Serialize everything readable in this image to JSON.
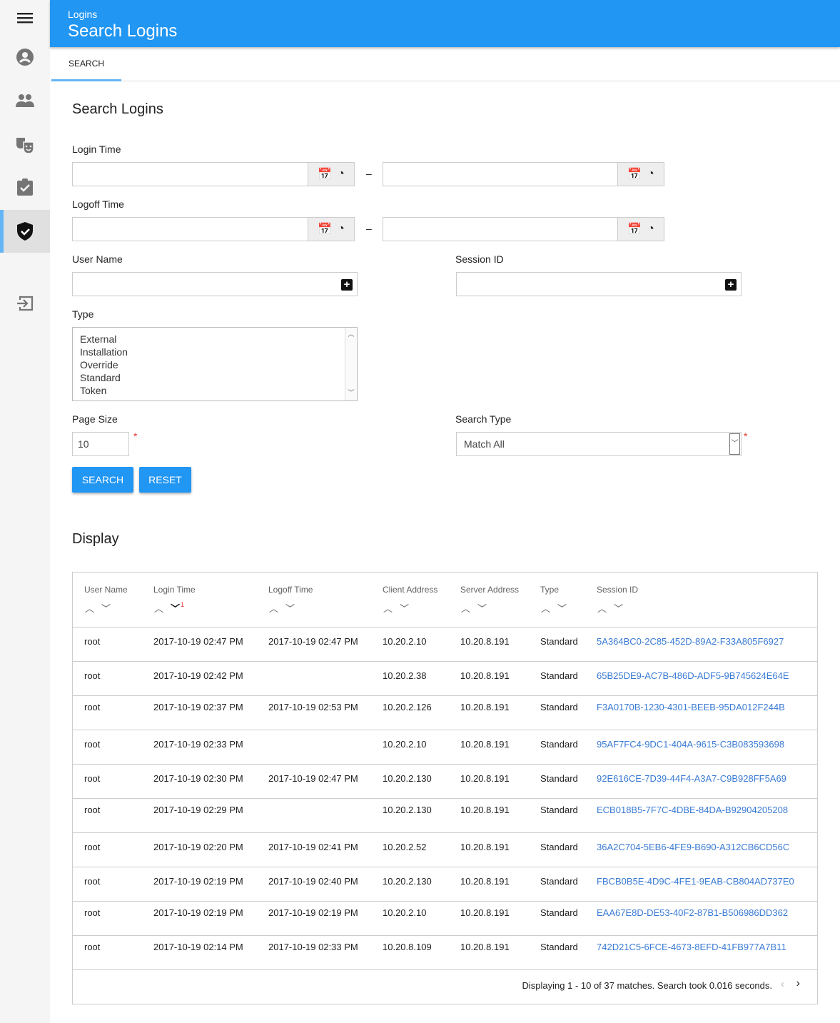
{
  "sidebar": {
    "items": [
      {
        "icon": "menu-icon"
      },
      {
        "icon": "account-circle-icon"
      },
      {
        "icon": "people-icon"
      },
      {
        "icon": "theater-masks-icon"
      },
      {
        "icon": "assignment-check-icon"
      },
      {
        "icon": "shield-check-icon",
        "active": true
      },
      {
        "icon": "logout-icon"
      }
    ]
  },
  "header": {
    "breadcrumb": "Logins",
    "title": "Search Logins"
  },
  "tabs": [
    {
      "label": "SEARCH",
      "active": true
    }
  ],
  "form": {
    "title": "Search Logins",
    "login_time_label": "Login Time",
    "logoff_time_label": "Logoff Time",
    "range_sep": "–",
    "user_name_label": "User Name",
    "session_id_label": "Session ID",
    "type_label": "Type",
    "type_options": [
      "External",
      "Installation",
      "Override",
      "Standard",
      "Token"
    ],
    "page_size_label": "Page Size",
    "page_size_value": "10",
    "search_type_label": "Search Type",
    "search_type_value": "Match All",
    "required_mark": "*",
    "search_button": "SEARCH",
    "reset_button": "RESET"
  },
  "display": {
    "title": "Display",
    "columns": [
      "User Name",
      "Login Time",
      "Logoff Time",
      "Client Address",
      "Server Address",
      "Type",
      "Session ID"
    ],
    "sort_indicator": "1",
    "rows": [
      [
        "root",
        "2017-10-19 02:47 PM",
        "2017-10-19 02:47 PM",
        "10.20.2.10",
        "10.20.8.191",
        "Standard",
        "5A364BC0-2C85-452D-89A2-F33A805F6927"
      ],
      [
        "root",
        "2017-10-19 02:42 PM",
        "",
        "10.20.2.38",
        "10.20.8.191",
        "Standard",
        "65B25DE9-AC7B-486D-ADF5-9B745624E64E"
      ],
      [
        "root",
        "2017-10-19 02:37 PM",
        "2017-10-19 02:53 PM",
        "10.20.2.126",
        "10.20.8.191",
        "Standard",
        "F3A0170B-1230-4301-BEEB-95DA012F244B"
      ],
      [
        "root",
        "2017-10-19 02:33 PM",
        "",
        "10.20.2.10",
        "10.20.8.191",
        "Standard",
        "95AF7FC4-9DC1-404A-9615-C3B083593698"
      ],
      [
        "root",
        "2017-10-19 02:30 PM",
        "2017-10-19 02:47 PM",
        "10.20.2.130",
        "10.20.8.191",
        "Standard",
        "92E616CE-7D39-44F4-A3A7-C9B928FF5A69"
      ],
      [
        "root",
        "2017-10-19 02:29 PM",
        "",
        "10.20.2.130",
        "10.20.8.191",
        "Standard",
        "ECB018B5-7F7C-4DBE-84DA-B92904205208"
      ],
      [
        "root",
        "2017-10-19 02:20 PM",
        "2017-10-19 02:41 PM",
        "10.20.2.52",
        "10.20.8.191",
        "Standard",
        "36A2C704-5EB6-4FE9-B690-A312CB6CD56C"
      ],
      [
        "root",
        "2017-10-19 02:19 PM",
        "2017-10-19 02:40 PM",
        "10.20.2.130",
        "10.20.8.191",
        "Standard",
        "FBCB0B5E-4D9C-4FE1-9EAB-CB804AD737E0"
      ],
      [
        "root",
        "2017-10-19 02:19 PM",
        "2017-10-19 02:19 PM",
        "10.20.2.10",
        "10.20.8.191",
        "Standard",
        "EAA67E8D-DE53-40F2-87B1-B506986DD362"
      ],
      [
        "root",
        "2017-10-19 02:14 PM",
        "2017-10-19 02:33 PM",
        "10.20.8.109",
        "10.20.8.191",
        "Standard",
        "742D21C5-6FCE-4673-8EFD-41FB977A7B11"
      ]
    ],
    "footer": "Displaying 1 - 10 of 37 matches. Search took 0.016 seconds."
  },
  "colors": {
    "primary": "#2196f3",
    "link": "#3a7bd5",
    "required": "#e53935"
  }
}
